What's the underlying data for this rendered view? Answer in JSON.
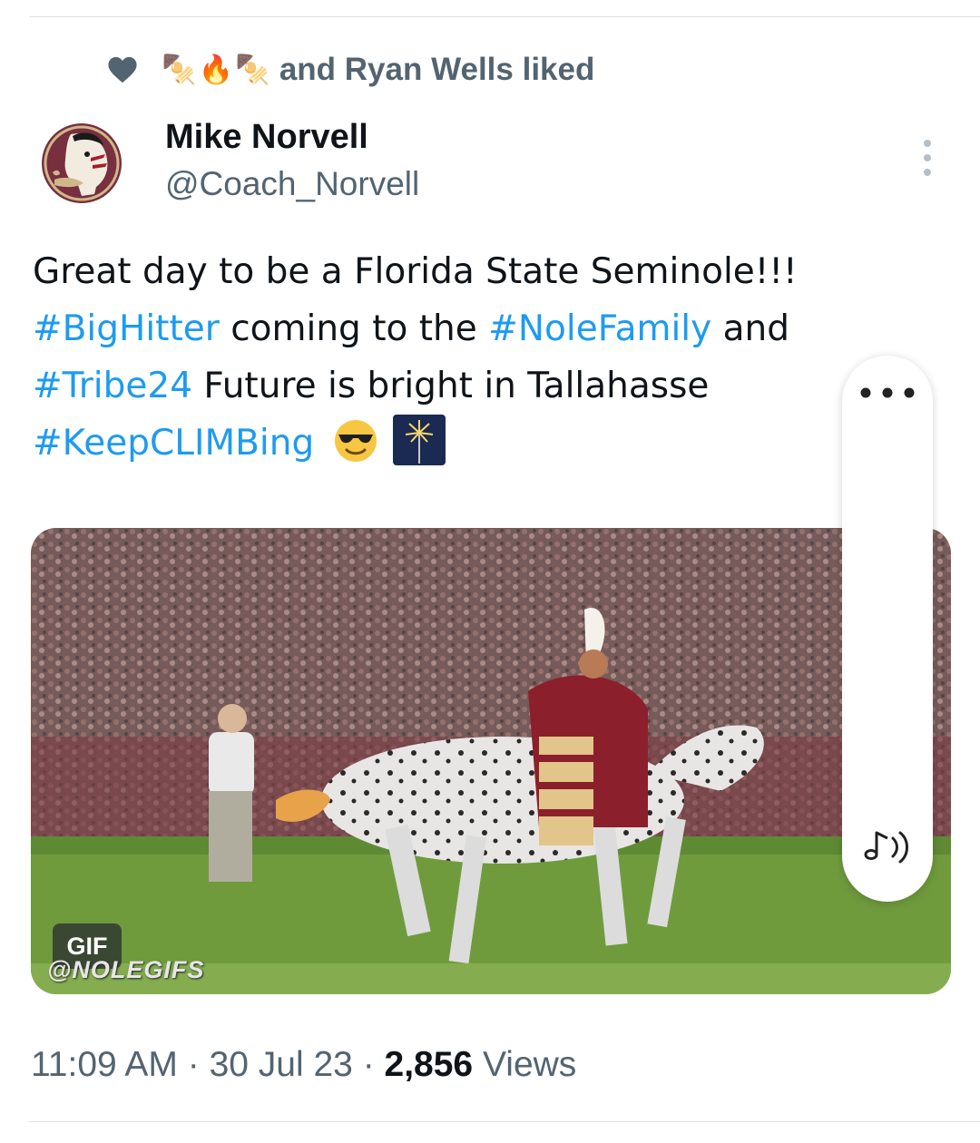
{
  "social_context": {
    "emojis": [
      "🍢",
      "🔥",
      "🍢"
    ],
    "text": "and Ryan Wells liked"
  },
  "author": {
    "name": "Mike Norvell",
    "handle": "@Coach_Norvell"
  },
  "tweet": {
    "lines": [
      [
        {
          "text": "Great day to be a Florida State Seminole!!!",
          "hashtag": false
        }
      ],
      [
        {
          "text": "#BigHitter",
          "hashtag": true
        },
        {
          "text": " coming to the ",
          "hashtag": false
        },
        {
          "text": "#NoleFamily",
          "hashtag": true
        },
        {
          "text": " and",
          "hashtag": false
        }
      ],
      [
        {
          "text": "#Tribe24",
          "hashtag": true
        },
        {
          "text": " Future is bright in Tallahasse",
          "hashtag": false
        }
      ],
      [
        {
          "text": "#KeepCLIMBing",
          "hashtag": true
        }
      ]
    ],
    "emojis": [
      "😎",
      "🎇"
    ]
  },
  "media": {
    "badge": "GIF",
    "watermark": "@NOLEGIFS"
  },
  "meta": {
    "time": "11:09 AM",
    "separator": " · ",
    "date": "30 Jul 23",
    "views_count": "2,856",
    "views_label": " Views"
  },
  "colors": {
    "link": "#1d9bf0",
    "text": "#0f1419",
    "secondary": "#536471",
    "fsu_garnet": "#782f40",
    "fsu_gold": "#ceb888"
  }
}
